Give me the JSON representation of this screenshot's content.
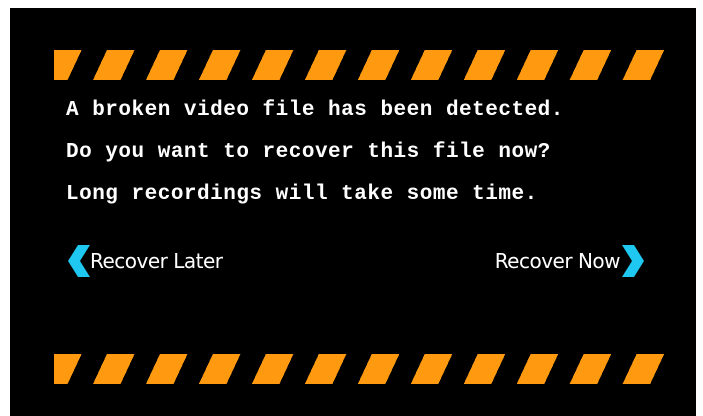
{
  "message": {
    "lines": [
      "A broken video file has been detected.",
      "Do you want to recover this file now?",
      "Long recordings will take some time."
    ]
  },
  "actions": {
    "recover_later_label": "Recover Later",
    "recover_now_label": "Recover Now"
  },
  "colors": {
    "background": "#000000",
    "stripe": "#ff9a10",
    "text": "#ffffff",
    "chevron": "#1ec8f0"
  },
  "icons": {
    "left": "chevron-left-icon",
    "right": "chevron-right-icon",
    "stripes": "hazard-stripes"
  }
}
